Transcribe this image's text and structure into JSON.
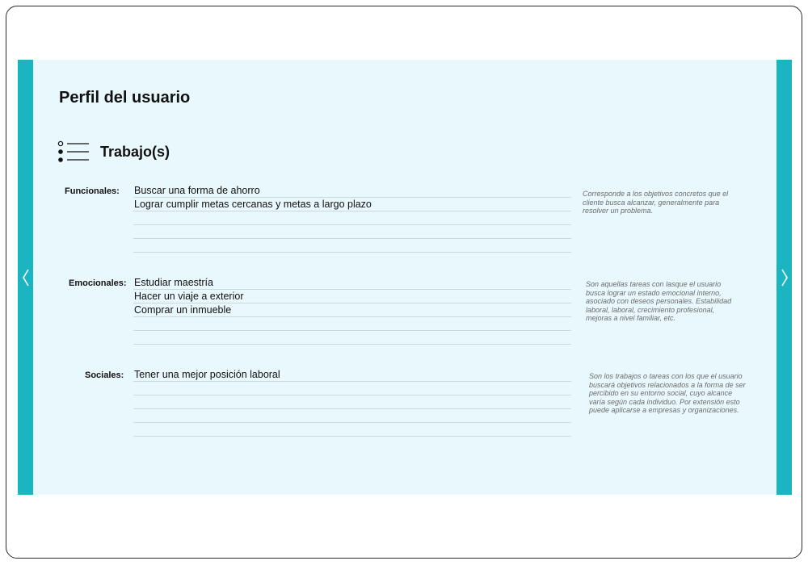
{
  "page": {
    "title": "Perfil del usuario",
    "section_title": "Trabajo(s)",
    "section_icon": "list-icon",
    "nav": {
      "prev_icon": "chevron-left-icon",
      "next_icon": "chevron-right-icon"
    }
  },
  "categories": [
    {
      "label": "Funcionales:",
      "lines": [
        "Buscar una forma de ahorro",
        "Lograr cumplir metas cercanas y metas a largo plazo",
        "",
        "",
        ""
      ],
      "note": "Corresponde a los objetivos concretos que el cliente busca alcanzar, generalmente para resolver un problema."
    },
    {
      "label": "Emocionales:",
      "lines": [
        "Estudiar maestría",
        "Hacer un viaje a exterior",
        "Comprar un inmueble",
        "",
        ""
      ],
      "note": "Son aquellas tareas con lasque el usuario busca lograr un estado emocional interno, asociado con deseos personales. Estabilidad laboral, laboral, crecimiento profesional, mejoras a nivel familiar, etc."
    },
    {
      "label": "Sociales:",
      "lines": [
        "Tener una mejor posición laboral",
        "",
        "",
        "",
        ""
      ],
      "note": "Son los trabajos o tareas con los que el usuario buscará objetivos relacionados a la forma de ser percibido en su entorno social, cuyo alcance varía según cada individuo. Por extensión esto puede aplicarse a empresas y organizaciones."
    }
  ],
  "colors": {
    "accent": "#1bb5c1",
    "panel_bg": "#e8f8fd",
    "rule": "#c9d9de"
  }
}
